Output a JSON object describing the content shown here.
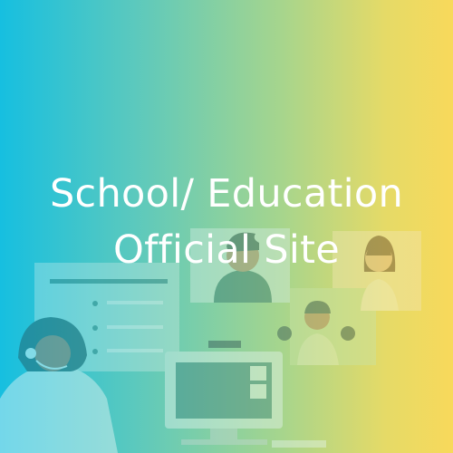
{
  "banner": {
    "title_line1": "School/ Education",
    "title_line2": "Official Site"
  },
  "colors": {
    "gradient_start": "#16bfe0",
    "gradient_end": "#f8d95b",
    "text": "#ffffff"
  },
  "illustration": {
    "icons": [
      "document-icon",
      "video-call-icon",
      "student-boy-icon",
      "student-girl-icon",
      "student-pigtails-icon",
      "teacher-headset-icon",
      "computer-monitor-icon"
    ]
  }
}
